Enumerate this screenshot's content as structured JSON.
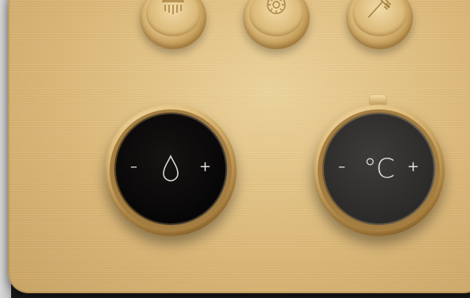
{
  "panel": {
    "small_knobs": [
      {
        "icon": "rain-shower-icon"
      },
      {
        "icon": "round-shower-icon"
      },
      {
        "icon": "hand-shower-icon"
      }
    ],
    "flow_control": {
      "icon": "water-drop-icon",
      "minus_label": "–",
      "plus_label": "+"
    },
    "temperature_control": {
      "unit_label": "°C",
      "minus_label": "–",
      "plus_label": "+"
    }
  },
  "colors": {
    "brushed_gold": "#dcb877",
    "flow_screen": "#070606",
    "temp_screen": "#2b2a29",
    "glyph": "#e0ddd8"
  }
}
